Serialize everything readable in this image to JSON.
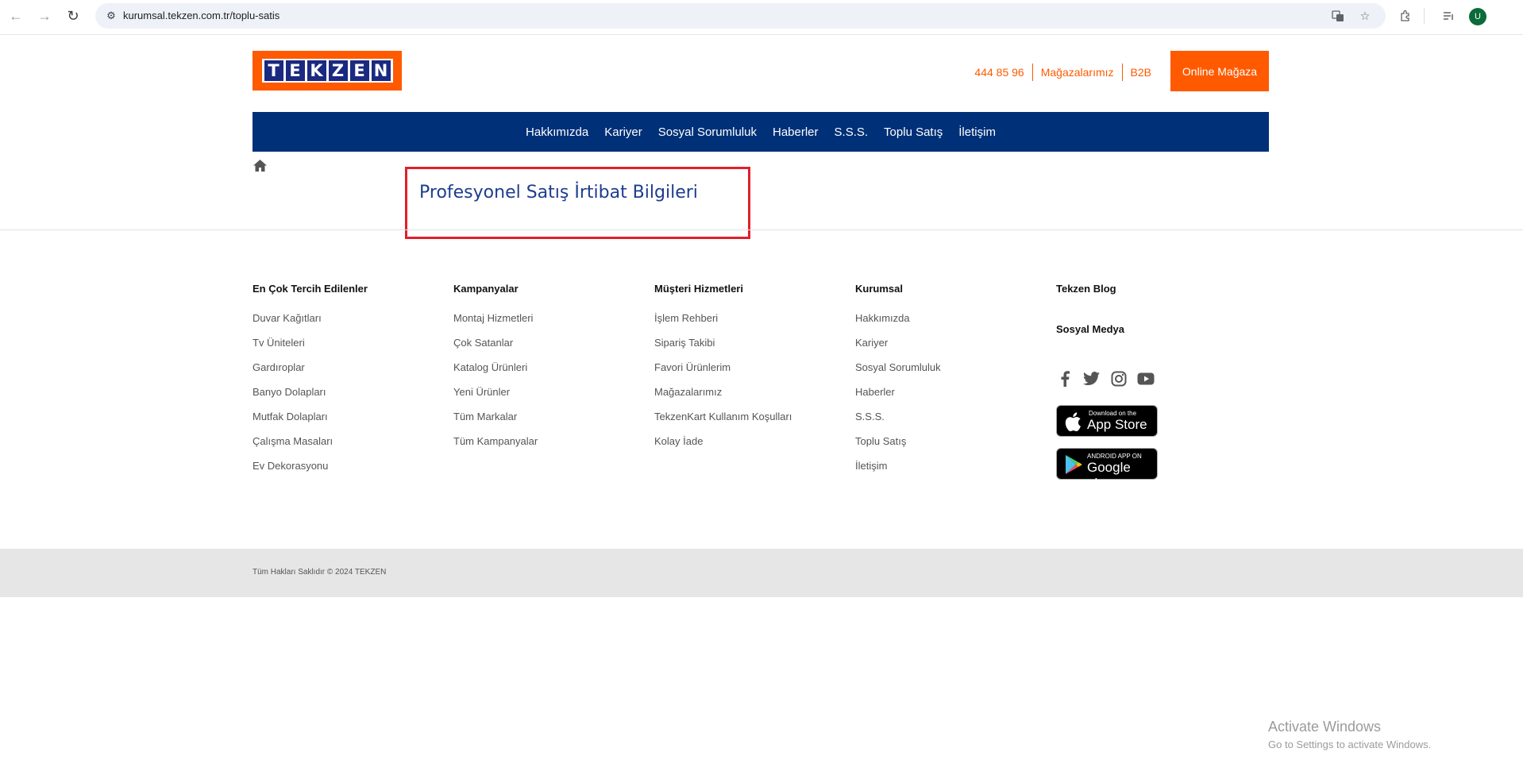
{
  "browser": {
    "url": "kurumsal.tekzen.com.tr/toplu-satis",
    "profile_initial": "U"
  },
  "header": {
    "logo_letters": [
      "T",
      "E",
      "K",
      "Z",
      "E",
      "N"
    ],
    "phone": "444 85 96",
    "stores_link": "Mağazalarımız",
    "b2b_link": "B2B",
    "online_store_button": "Online Mağaza",
    "accent_color": "#ff5a00",
    "nav_color": "#003078"
  },
  "nav": {
    "items": [
      "Hakkımızda",
      "Kariyer",
      "Sosyal Sorumluluk",
      "Haberler",
      "S.S.S.",
      "Toplu Satış",
      "İletişim"
    ]
  },
  "main": {
    "title": "Profesyonel Satış İrtibat Bilgileri"
  },
  "footer": {
    "columns": [
      {
        "title": "En Çok Tercih Edilenler",
        "items": [
          "Duvar Kağıtları",
          "Tv Üniteleri",
          "Gardıroplar",
          "Banyo Dolapları",
          "Mutfak Dolapları",
          "Çalışma Masaları",
          "Ev Dekorasyonu"
        ]
      },
      {
        "title": "Kampanyalar",
        "items": [
          "Montaj Hizmetleri",
          "Çok Satanlar",
          "Katalog Ürünleri",
          "Yeni Ürünler",
          "Tüm Markalar",
          "Tüm Kampanyalar"
        ]
      },
      {
        "title": "Müşteri Hizmetleri",
        "items": [
          "İşlem Rehberi",
          "Sipariş Takibi",
          "Favori Ürünlerim",
          "Mağazalarımız",
          "TekzenKart Kullanım Koşulları",
          "Kolay İade"
        ]
      },
      {
        "title": "Kurumsal",
        "items": [
          "Hakkımızda",
          "Kariyer",
          "Sosyal Sorumluluk",
          "Haberler",
          "S.S.S.",
          "Toplu Satış",
          "İletişim"
        ]
      }
    ],
    "blog_title": "Tekzen Blog",
    "social_title": "Sosyal Medya",
    "app_store_small": "Download on the",
    "app_store_big": "App Store",
    "google_play_small": "ANDROID APP ON",
    "google_play_big": "Google play",
    "copyright": "Tüm Hakları Saklıdır © 2024 TEKZEN"
  },
  "watermark": {
    "line1": "Activate Windows",
    "line2": "Go to Settings to activate Windows."
  }
}
